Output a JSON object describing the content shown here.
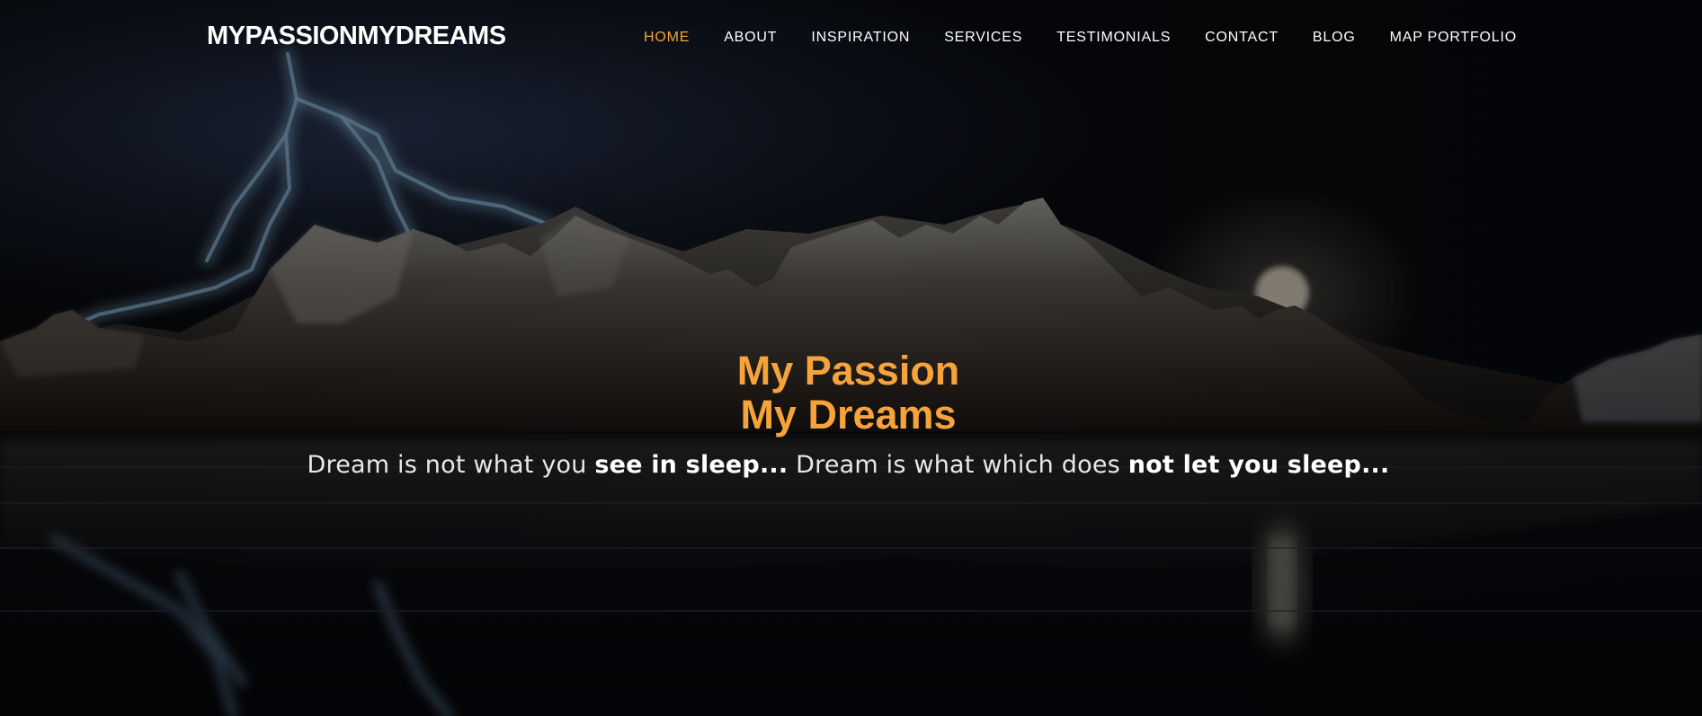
{
  "brand": {
    "name": "MYPASSIONMYDREAMS"
  },
  "nav": {
    "items": [
      {
        "label": "HOME",
        "active": true
      },
      {
        "label": "ABOUT"
      },
      {
        "label": "INSPIRATION"
      },
      {
        "label": "SERVICES"
      },
      {
        "label": "TESTIMONIALS"
      },
      {
        "label": "CONTACT"
      },
      {
        "label": "BLOG"
      },
      {
        "label": "MAP PORTFOLIO"
      }
    ]
  },
  "hero": {
    "title_line1": "My Passion",
    "title_line2": "My Dreams",
    "subtitle": {
      "part1": "Dream is not what you ",
      "part2": "see in sleep...",
      "part3": " Dream is what which does ",
      "part4": "not let you sleep..."
    },
    "background": {
      "image": "night mountains reflected in water with lightning and full moon",
      "icons": [
        "lightning-bolt",
        "moon"
      ]
    }
  },
  "colors": {
    "accent": "#f5a33a",
    "text": "#ffffff",
    "background": "#07080c"
  }
}
